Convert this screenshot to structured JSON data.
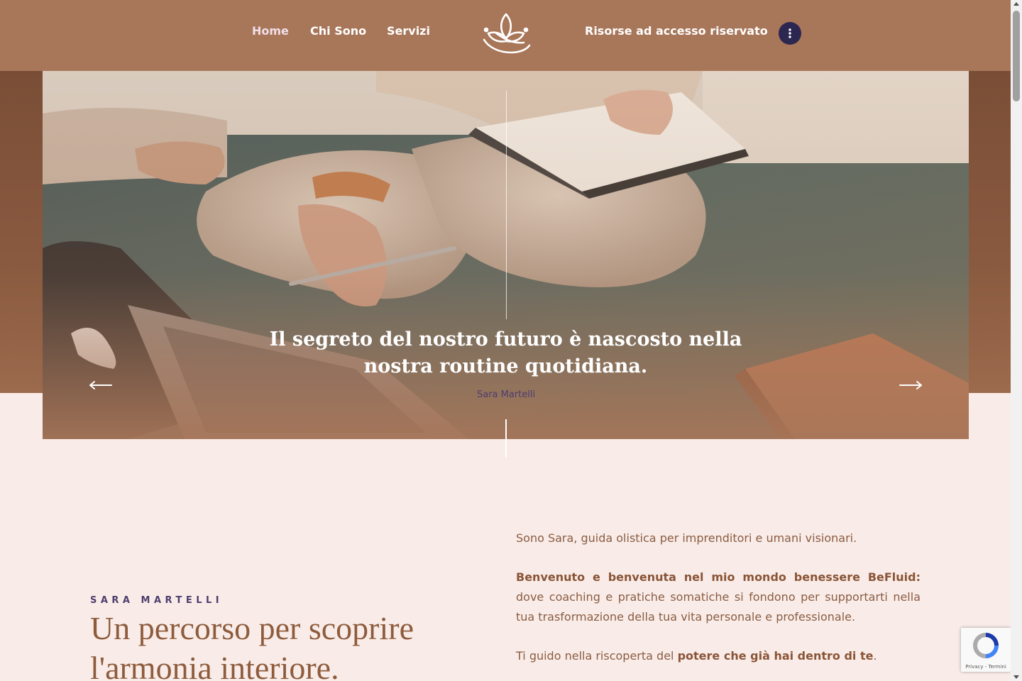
{
  "nav": {
    "items": [
      {
        "label": "Home",
        "active": true
      },
      {
        "label": "Chi Sono",
        "active": false
      },
      {
        "label": "Servizi",
        "active": false
      }
    ],
    "reserved_label": "Risorse ad accesso riservato",
    "logo_icon": "lotus-icon",
    "menu_icon": "vertical-dots-icon"
  },
  "hero": {
    "quote": "Il segreto del nostro futuro è nascosto nella nostra routine quotidiana.",
    "author": "Sara Martelli",
    "prev_icon": "arrow-left-icon",
    "next_icon": "arrow-right-icon"
  },
  "intro": {
    "eyebrow": "SARA MARTELLI",
    "title": "Un percorso per scoprire l'armonia interiore.",
    "p1": "Sono Sara, guida olistica per imprenditori e umani visionari.",
    "p2_bold": "Benvenuto e benvenuta nel mio mondo benessere BeFluid:",
    "p2_rest": " dove coaching e pratiche somatiche si fondono per supportarti nella tua trasformazione della tua vita personale e professionale.",
    "p3_start": "Ti guido nella riscoperta del ",
    "p3_bold": "potere che già hai dentro di te",
    "p3_end": "."
  },
  "recaptcha": {
    "links": "Privacy - Termini"
  },
  "colors": {
    "header_bg": "#a87659",
    "page_bg": "#f9ece8",
    "accent_purple": "#4d3d6e",
    "title_brown": "#8e5c3d",
    "menu_button": "#2c2750"
  }
}
